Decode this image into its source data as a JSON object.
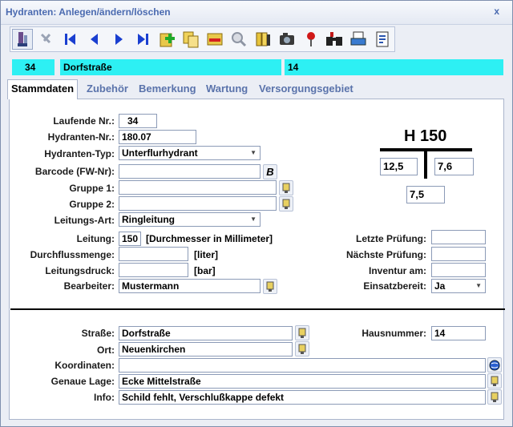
{
  "window": {
    "title": "Hydranten: Anlegen/ändern/löschen",
    "close_symbol": "x"
  },
  "toolbar": {
    "icons": [
      "pen-icon",
      "save-icon",
      "first-record-icon",
      "previous-record-icon",
      "next-record-icon",
      "last-record-icon",
      "add-icon",
      "copy-icon",
      "delete-icon",
      "search-icon",
      "books-icon",
      "camera-icon",
      "pin-icon",
      "binoculars-icon",
      "print-icon",
      "report-icon"
    ]
  },
  "infobar": {
    "nr": "34",
    "street": "Dorfstraße",
    "house": "14"
  },
  "tabs": [
    "Stammdaten",
    "Zubehör",
    "Bemerkung",
    "Wartung",
    "Versorgungsgebiet"
  ],
  "form": {
    "laufende_nr_label": "Laufende Nr.:",
    "laufende_nr": "34",
    "hydranten_nr_label": "Hydranten-Nr.:",
    "hydranten_nr": "180.07",
    "typ_label": "Hydranten-Typ:",
    "typ": "Unterflurhydrant",
    "barcode_label": "Barcode (FW-Nr):",
    "barcode": "",
    "barcode_btn": "B",
    "gruppe1_label": "Gruppe 1:",
    "gruppe1": "",
    "gruppe2_label": "Gruppe 2:",
    "gruppe2": "",
    "leitungsart_label": "Leitungs-Art:",
    "leitungsart": "Ringleitung",
    "leitung_label": "Leitung:",
    "leitung": "150",
    "leitung_unit": "[Durchmesser in Millimeter]",
    "durchfluss_label": "Durchflussmenge:",
    "durchfluss": "",
    "durchfluss_unit": "[liter]",
    "druck_label": "Leitungsdruck:",
    "druck": "",
    "druck_unit": "[bar]",
    "bearbeiter_label": "Bearbeiter:",
    "bearbeiter": "Mustermann",
    "letzte_label": "Letzte Prüfung:",
    "letzte": "",
    "naechste_label": "Nächste Prüfung:",
    "naechste": "",
    "inventur_label": "Inventur am:",
    "inventur": "",
    "einsatz_label": "Einsatzbereit:",
    "einsatz": "Ja"
  },
  "sign": {
    "title": "H 150",
    "left": "12,5",
    "right": "7,6",
    "bottom": "7,5"
  },
  "address": {
    "strasse_label": "Straße:",
    "strasse": "Dorfstraße",
    "hausnr_label": "Hausnummer:",
    "hausnr": "14",
    "ort_label": "Ort:",
    "ort": "Neuenkirchen",
    "koord_label": "Koordinaten:",
    "koord": "",
    "lage_label": "Genaue Lage:",
    "lage": "Ecke Mittelstraße",
    "info_label": "Info:",
    "info": "Schild fehlt, Verschlußkappe defekt"
  }
}
